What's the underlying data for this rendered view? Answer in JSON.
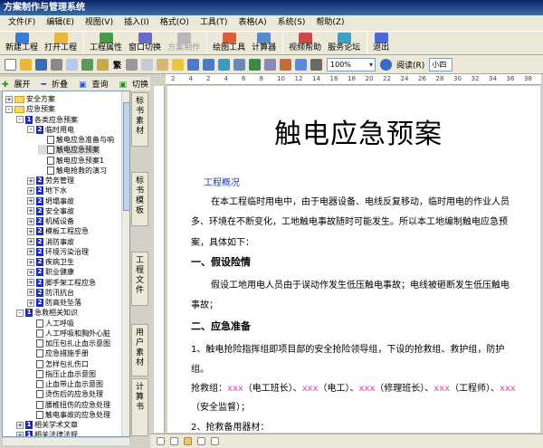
{
  "window": {
    "title": "方案制作与管理系统"
  },
  "menu": {
    "items": [
      {
        "label": "文件(F)"
      },
      {
        "label": "编辑(E)"
      },
      {
        "label": "视图(V)"
      },
      {
        "label": "插入(I)"
      },
      {
        "label": "格式(O)"
      },
      {
        "label": "工具(T)"
      },
      {
        "label": "表格(A)"
      },
      {
        "label": "系统(S)"
      },
      {
        "label": "帮助(Z)"
      }
    ]
  },
  "toolbar": {
    "buttons": [
      {
        "label": "新建工程",
        "icon": "new-project-icon",
        "color": "#3a7bd5",
        "disabled": false
      },
      {
        "label": "打开工程",
        "icon": "open-project-icon",
        "color": "#e8b83a",
        "disabled": false
      },
      {
        "label": "工程属性",
        "icon": "project-properties-icon",
        "color": "#4a9a4a",
        "disabled": false
      },
      {
        "label": "窗口切换",
        "icon": "window-switch-icon",
        "color": "#6a6ac8",
        "disabled": false
      },
      {
        "label": "方案制作",
        "icon": "plan-make-icon",
        "color": "#b8b8b8",
        "disabled": true
      },
      {
        "label": "绘图工具",
        "icon": "drawing-tool-icon",
        "color": "#d8603a",
        "disabled": false
      },
      {
        "label": "计算器",
        "icon": "calculator-icon",
        "color": "#5a8ac8",
        "disabled": false
      },
      {
        "label": "视频帮助",
        "icon": "video-help-icon",
        "color": "#c84a4a",
        "disabled": false
      },
      {
        "label": "服务论坛",
        "icon": "forum-icon",
        "color": "#3aa0c8",
        "disabled": false
      },
      {
        "label": "退出",
        "icon": "exit-icon",
        "color": "#4a6ad8",
        "disabled": false
      }
    ]
  },
  "format_toolbar": {
    "zoom": "100%",
    "read_label": "阅读(R)",
    "font_box": "小四",
    "style_label": "繁"
  },
  "tree_toolbar": {
    "expand": "展开",
    "collapse": "折叠",
    "search": "查询",
    "switch": "切换"
  },
  "tree": {
    "nodes": [
      {
        "label": "安全方案",
        "type": "folder",
        "toggle": "+"
      },
      {
        "label": "应急预案",
        "type": "folder",
        "toggle": "-"
      },
      {
        "label": "各类应急预案",
        "type": "num",
        "num": "1",
        "toggle": "-"
      },
      {
        "label": "临时用电",
        "type": "num",
        "num": "2",
        "toggle": "-"
      },
      {
        "label": "触电应急准备与响",
        "type": "doc"
      },
      {
        "label": "触电应急预案",
        "type": "doc",
        "selected": true
      },
      {
        "label": "触电应急预案1",
        "type": "doc"
      },
      {
        "label": "触电抢救的演习",
        "type": "doc"
      },
      {
        "label": "劳务管理",
        "type": "num",
        "num": "2",
        "toggle": "+"
      },
      {
        "label": "地下水",
        "type": "num",
        "num": "2",
        "toggle": "+"
      },
      {
        "label": "坍塌事故",
        "type": "num",
        "num": "2",
        "toggle": "+"
      },
      {
        "label": "安全事故",
        "type": "num",
        "num": "2",
        "toggle": "+"
      },
      {
        "label": "机械设备",
        "type": "num",
        "num": "2",
        "toggle": "+"
      },
      {
        "label": "模板工程应急",
        "type": "num",
        "num": "2",
        "toggle": "+"
      },
      {
        "label": "消防事故",
        "type": "num",
        "num": "2",
        "toggle": "+"
      },
      {
        "label": "环境污染治理",
        "type": "num",
        "num": "2",
        "toggle": "+"
      },
      {
        "label": "疾病卫生",
        "type": "num",
        "num": "2",
        "toggle": "+"
      },
      {
        "label": "职业健康",
        "type": "num",
        "num": "2",
        "toggle": "+"
      },
      {
        "label": "脚手架工程应急",
        "type": "num",
        "num": "2",
        "toggle": "+"
      },
      {
        "label": "防汛抗台",
        "type": "num",
        "num": "2",
        "toggle": "+"
      },
      {
        "label": "防高处坠落",
        "type": "num",
        "num": "2",
        "toggle": "+"
      },
      {
        "label": "急救相关知识",
        "type": "num",
        "num": "1",
        "toggle": "-"
      },
      {
        "label": "人工呼吸",
        "type": "doc"
      },
      {
        "label": "人工呼吸和胸外心脏",
        "type": "doc"
      },
      {
        "label": "加压包扎止血示意图",
        "type": "doc"
      },
      {
        "label": "应急措施手册",
        "type": "doc"
      },
      {
        "label": "怎样包扎伤口",
        "type": "doc"
      },
      {
        "label": "指压止血示意图",
        "type": "doc"
      },
      {
        "label": "止血带止血示意图",
        "type": "doc"
      },
      {
        "label": "烫伤后的应急处理",
        "type": "doc"
      },
      {
        "label": "腰椎扭伤的应急处理",
        "type": "doc"
      },
      {
        "label": "触电事故的应急处理",
        "type": "doc"
      },
      {
        "label": "相关学术文章",
        "type": "num",
        "num": "1",
        "toggle": "+"
      },
      {
        "label": "相关法律法规",
        "type": "num",
        "num": "1",
        "toggle": "+"
      }
    ]
  },
  "side_tabs": [
    {
      "label": "标书素材"
    },
    {
      "label": "标书模板"
    },
    {
      "label": "工程文件"
    },
    {
      "label": "用户素材"
    },
    {
      "label": "计算书"
    }
  ],
  "ruler": {
    "ticks": [
      "2",
      "4",
      "2",
      "4",
      "6",
      "8",
      "10",
      "12",
      "14",
      "16",
      "18",
      "20",
      "22",
      "24",
      "26",
      "28",
      "30",
      "32",
      "34",
      "36",
      "38"
    ]
  },
  "document": {
    "title": "触电应急预案",
    "section0_heading": "工程概况",
    "p1_line1": "在本工程临时用电中，由于电器设备、电线反复移动，临时用电的作业人员",
    "p1_line2": "多、环境在不断变化，工地触电事故随时可能发生。所以本工地编制触电应急预",
    "p1_line3": "案，具体如下：",
    "section1_heading": "一、假设险情",
    "p2_line1": "假设工地用电人员由于误动作发生低压触电事故；电线被砸断发生低压触电",
    "p2_line2": "事故；",
    "section2_heading": "二、应急准备",
    "p3_line1": "1、触电抢险指挥组即项目部的安全抢险领导组，下设的抢救组、救护组，防护",
    "p3_line2": "组。",
    "p4_prefix": "抢救组：",
    "xxx": "xxx",
    "role1": "（电工班长）、",
    "role2": "（电工）、",
    "role3": "（修理班长）、",
    "role4": "（工程师）、",
    "p4_line2": "（安全监督）；",
    "p5_line1": "2、抢救备用器材："
  }
}
